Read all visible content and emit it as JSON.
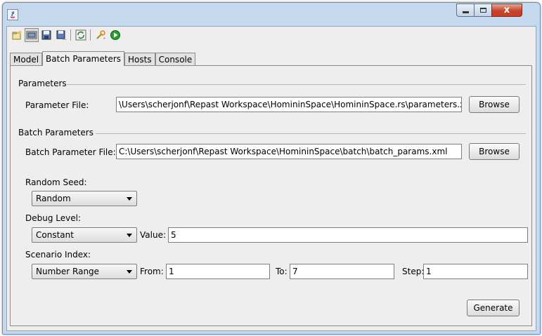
{
  "window": {
    "close_glyph": "x",
    "colors": {
      "frame": "#c5d9ee",
      "close": "#c8432b",
      "run_green": "#2a9d2a"
    }
  },
  "toolbar": {
    "icons": [
      "new-scenario-icon",
      "open-folder-icon",
      "save-icon",
      "save-as-icon",
      "refresh-icon",
      "configure-icon",
      "run-icon"
    ]
  },
  "tabs": [
    {
      "label": "Model",
      "active": false
    },
    {
      "label": "Batch Parameters",
      "active": true
    },
    {
      "label": "Hosts",
      "active": false
    },
    {
      "label": "Console",
      "active": false
    }
  ],
  "parameters": {
    "section_title": "Parameters",
    "file_label": "Parameter File:",
    "file_value": "\\Users\\scherjonf\\Repast Workspace\\HomininSpace\\HomininSpace.rs\\parameters.xml",
    "browse_label": "Browse"
  },
  "batch": {
    "section_title": "Batch Parameters",
    "file_label": "Batch Parameter File:",
    "file_value": "C:\\Users\\scherjonf\\Repast Workspace\\HomininSpace\\batch\\batch_params.xml",
    "browse_label": "Browse"
  },
  "random_seed": {
    "label": "Random Seed:",
    "selected": "Random"
  },
  "debug_level": {
    "label": "Debug Level:",
    "selected": "Constant",
    "value_label": "Value:",
    "value": "5"
  },
  "scenario_index": {
    "label": "Scenario Index:",
    "selected": "Number Range",
    "from_label": "From:",
    "from_value": "1",
    "to_label": "To:",
    "to_value": "7",
    "step_label": "Step:",
    "step_value": "1"
  },
  "generate_label": "Generate"
}
